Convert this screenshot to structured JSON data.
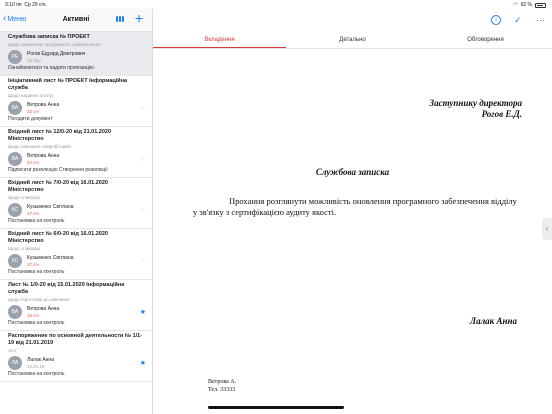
{
  "status": {
    "time": "3:10 пп",
    "date": "Ср 29 січ.",
    "battery": "92 %"
  },
  "navbar": {
    "back_label": "Меню",
    "title": "Активні"
  },
  "list": [
    {
      "title": "Службова записка № ПРОЕКТ",
      "subtitle": "Щодо оновлення програмного забезпечення",
      "initials": "РЕ",
      "name": "Рогов Едуард Дмитрович",
      "date": "12 бер",
      "date_style": "grey",
      "task": "Ознайомитися та надати пропозицію",
      "starred": false,
      "selected": true
    },
    {
      "title": "Ініціативний лист № ПРОЕКТ Інформаційна служба",
      "subtitle": "Щодо надання послуг",
      "initials": "ВА",
      "name": "Ветрова Анна",
      "date": "22 січ",
      "date_style": "red",
      "task": "Погодити документ",
      "starred": false,
      "selected": false
    },
    {
      "title": "Вхідний лист № 12/0-20 від 21.01.2020 Міністерство",
      "subtitle": "Щодо навчання співробітників",
      "initials": "ВА",
      "name": "Ветрова Анна",
      "date": "22 січ",
      "date_style": "red",
      "task": "Підписати резолюцію Створення резолюції",
      "starred": false,
      "selected": false
    },
    {
      "title": "Вхідний лист № 7/0-20 від 16.01.2020 Міністерство",
      "subtitle": "Щодо співпраці",
      "initials": "КС",
      "name": "Кузьменко Світлана",
      "date": "17 січ",
      "date_style": "red",
      "task": "Постановка на контроль",
      "starred": false,
      "selected": false
    },
    {
      "title": "Вхідний лист № 6/0-20 від 16.01.2020 Міністерство",
      "subtitle": "Щодо співпраці",
      "initials": "КС",
      "name": "Кузьменко Світлана",
      "date": "17 січ",
      "date_style": "red",
      "task": "Постановка на контроль",
      "starred": false,
      "selected": false
    },
    {
      "title": "Лист № 1/0-20 від 15.01.2020 Інформаційна служба",
      "subtitle": "Щодо підготовки до навчання",
      "initials": "ВА",
      "name": "Ветрова Анна",
      "date": "16 січ",
      "date_style": "red",
      "task": "Постановка на контроль",
      "starred": true,
      "selected": false
    },
    {
      "title": "Распоряжение по основной деятельности № 1/1-19 від 21.01.2019",
      "subtitle": "тест",
      "initials": "ЛА",
      "name": "Лалак Анна",
      "date": "22.01.19",
      "date_style": "grey",
      "task": "Постановка на контроль",
      "starred": true,
      "selected": false
    }
  ],
  "tabs": [
    "Вкладення",
    "Детально",
    "Обговорення"
  ],
  "document": {
    "addressee_line1": "Заступнику директора",
    "addressee_line2": "Рогов Е.Д.",
    "heading": "Службова записка",
    "body": "Прохання розглянути можливість оновлення програмного забезпечення відділу у зв'язку з сертифікацією аудиту якості.",
    "signer": "Лалак Анна",
    "executor_name": "Ветрова А.",
    "executor_phone": "Тел. 33333"
  },
  "colors": {
    "accent": "#1a7cf4",
    "active_tab": "#d93636",
    "overdue": "#e0563b"
  }
}
